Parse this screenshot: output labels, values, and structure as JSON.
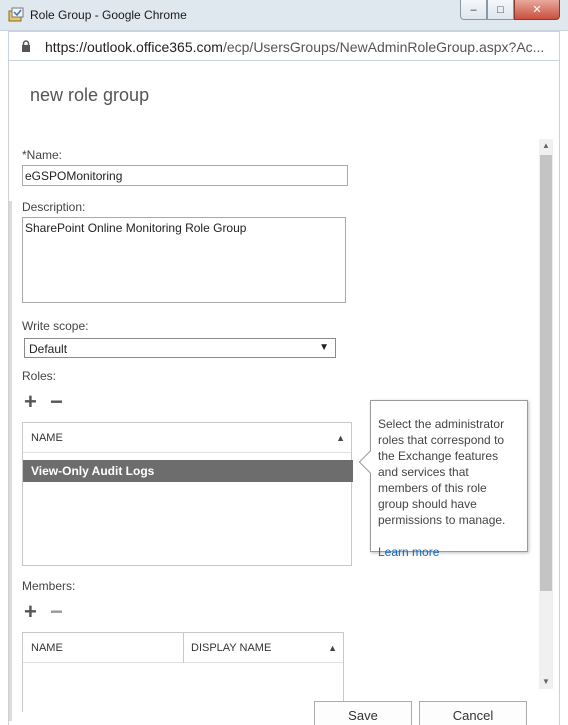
{
  "window": {
    "title": "Role Group - Google Chrome",
    "minimize": "–",
    "restore": "□",
    "close": "✕"
  },
  "address": {
    "host": "https://outlook.office365.com",
    "path": "/ecp/UsersGroups/NewAdminRoleGroup.aspx?Ac..."
  },
  "page": {
    "heading": "new role group"
  },
  "form": {
    "name_label": "*Name:",
    "name_value": "eGSPOMonitoring",
    "description_label": "Description:",
    "description_value": "SharePoint Online Monitoring Role Group",
    "write_scope_label": "Write scope:",
    "write_scope_value": "Default",
    "roles_label": "Roles:",
    "members_label": "Members:"
  },
  "roles_grid": {
    "col_name": "NAME",
    "selected_row": "View-Only Audit Logs"
  },
  "members_grid": {
    "col_name": "NAME",
    "col_display_name": "DISPLAY NAME"
  },
  "callout": {
    "text": "Select the administrator roles that correspond to the Exchange features and services that members of this role group should have permissions to manage.",
    "link": "Learn more"
  },
  "buttons": {
    "save": "Save",
    "cancel": "Cancel"
  },
  "icons": {
    "add": "+",
    "remove": "−",
    "sort_asc": "▲",
    "dropdown": "▼",
    "scroll_up": "▲",
    "scroll_down": "▼"
  }
}
